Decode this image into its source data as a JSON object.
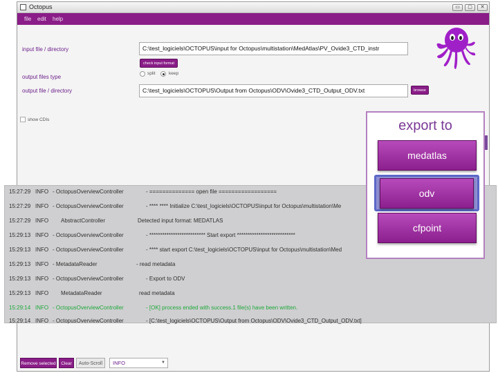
{
  "window": {
    "title": "Octopus",
    "buttons": [
      "▭",
      "▢",
      "✕"
    ]
  },
  "menu": {
    "file": "file",
    "edit": "edit",
    "help": "help"
  },
  "form": {
    "input_label": "input file / directory",
    "input_value": "C:\\test_logiciels\\OCTOPUS\\input for Octopus\\multistation\\MedAtlas\\PV_Ovide3_CTD_instr",
    "check_button": "check input format",
    "output_type_label": "output files type",
    "option_split": "split",
    "option_keep": "keep",
    "output_label": "output file / directory",
    "output_value": "C:\\test_logiciels\\OCTOPUS\\Output from Octopus\\ODV\\Ovide3_CTD_Output_ODV.txt",
    "browse_button": "browse",
    "show_cdis": "show CDIs"
  },
  "log": [
    {
      "time": "15:27:29",
      "level": "INFO",
      "source": "- OctopusOverviewController",
      "message": "- ============== open file ==================",
      "color": "#2e2e2e"
    },
    {
      "time": "15:27:29",
      "level": "INFO",
      "source": "- OctopusOverviewController",
      "message": "- **** **** Initialize C:\\test_logiciels\\OCTOPUS\\input for Octopus\\multistation\\Me",
      "color": "#2e2e2e"
    },
    {
      "time": "15:27:29",
      "level": "INFO",
      "source": "AbstractController",
      "message": "Detected input format: MEDATLAS",
      "color": "#2e2e2e"
    },
    {
      "time": "15:29:13",
      "level": "INFO",
      "source": "- OctopusOverviewController",
      "message": "- ************************** Start export ***************************",
      "color": "#2e2e2e"
    },
    {
      "time": "15:29:13",
      "level": "INFO",
      "source": "- OctopusOverviewController",
      "message": "- **** start export C:\\test_logiciels\\OCTOPUS\\input for Octopus\\multistation\\Med",
      "color": "#2e2e2e"
    },
    {
      "time": "15:29:13",
      "level": "INFO",
      "source": "- MetadataReader",
      "message": "- read metadata",
      "color": "#2e2e2e"
    },
    {
      "time": "15:29:13",
      "level": "INFO",
      "source": "- OctopusOverviewController",
      "message": "- Export to ODV",
      "color": "#2e2e2e"
    },
    {
      "time": "15:29:13",
      "level": "INFO",
      "source": "MetadataReader",
      "message": "read metadata",
      "color": "#2e2e2e"
    },
    {
      "time": "15:29:14",
      "level": "INFO",
      "source": "- OctopusOverviewController",
      "message": "- [OK] process ended with success.1 file(s) have been written.",
      "color": "#1ea83a"
    },
    {
      "time": "15:29:14",
      "level": "INFO",
      "source": "- OctopusOverviewController",
      "message": "- [C:\\test_logiciels\\OCTOPUS\\Output from Octopus\\ODV\\Ovide3_CTD_Output_ODV.txt]",
      "color": "#2e2e2e"
    }
  ],
  "export": {
    "title": "export to",
    "buttons": [
      "medatlas",
      "odv",
      "cfpoint"
    ],
    "selected": "odv"
  },
  "bottom": {
    "remove_selected": "Remove selected",
    "clear": "Clear",
    "auto_scroll": "Auto-Scroll",
    "level_value": "INFO"
  },
  "colors": {
    "accent": "#8a1d88",
    "log_ok": "#1ea83a"
  }
}
